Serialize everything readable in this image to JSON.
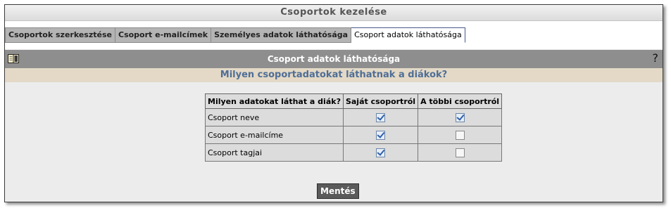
{
  "title": "Csoportok kezelése",
  "tabs": [
    {
      "label": "Csoportok szerkesztése",
      "active": false
    },
    {
      "label": "Csoport e-mailcímek",
      "active": false
    },
    {
      "label": "Személyes adatok láthatósága",
      "active": false
    },
    {
      "label": "Csoport adatok láthatósága",
      "active": true
    }
  ],
  "section": {
    "title": "Csoport adatok láthatósága",
    "icon": "book-icon",
    "help_label": "?"
  },
  "question": "Milyen csoportadatokat láthatnak a diákok?",
  "table": {
    "headers": [
      "Milyen adatokat láthat a diák?",
      "Saját csoportról",
      "A többi csoportról"
    ],
    "rows": [
      {
        "label": "Csoport neve",
        "own": true,
        "others": true
      },
      {
        "label": "Csoport e-mailcíme",
        "own": true,
        "others": false
      },
      {
        "label": "Csoport tagjai",
        "own": true,
        "others": false
      }
    ]
  },
  "save_label": "Mentés",
  "colors": {
    "section_header_bg": "#8e8e8e",
    "question_bg": "#e3d9c6",
    "question_text": "#4f6e96",
    "tab_bg": "#b4b4b4",
    "save_button_bg": "#5a5a5a"
  }
}
